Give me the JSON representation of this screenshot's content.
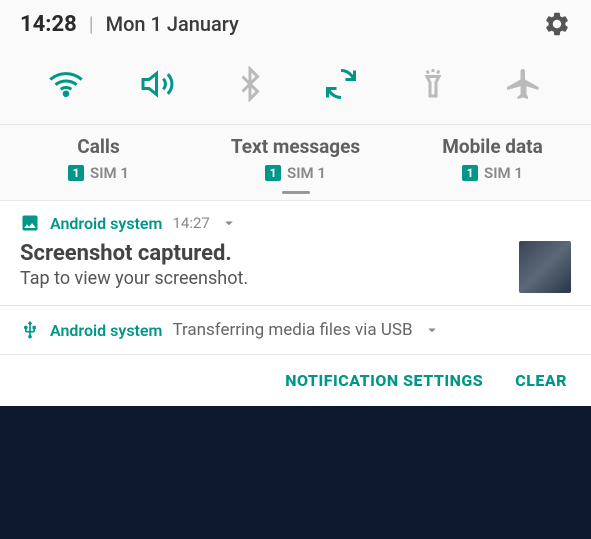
{
  "status": {
    "time": "14:28",
    "date": "Mon 1 January"
  },
  "toggles": {
    "wifi": {
      "active": true
    },
    "sound": {
      "active": true
    },
    "bluetooth": {
      "active": false
    },
    "rotate": {
      "active": true
    },
    "flashlight": {
      "active": false
    },
    "airplane": {
      "active": false
    }
  },
  "sim": {
    "calls": {
      "title": "Calls",
      "badge": "1",
      "name": "SIM 1"
    },
    "texts": {
      "title": "Text messages",
      "badge": "1",
      "name": "SIM 1"
    },
    "data": {
      "title": "Mobile data",
      "badge": "1",
      "name": "SIM 1"
    }
  },
  "notif1": {
    "app": "Android system",
    "time": "14:27",
    "title": "Screenshot captured.",
    "desc": "Tap to view your screenshot."
  },
  "notif2": {
    "app": "Android system",
    "extra": "Transferring media files via USB"
  },
  "actions": {
    "settings": "NOTIFICATION SETTINGS",
    "clear": "CLEAR"
  }
}
